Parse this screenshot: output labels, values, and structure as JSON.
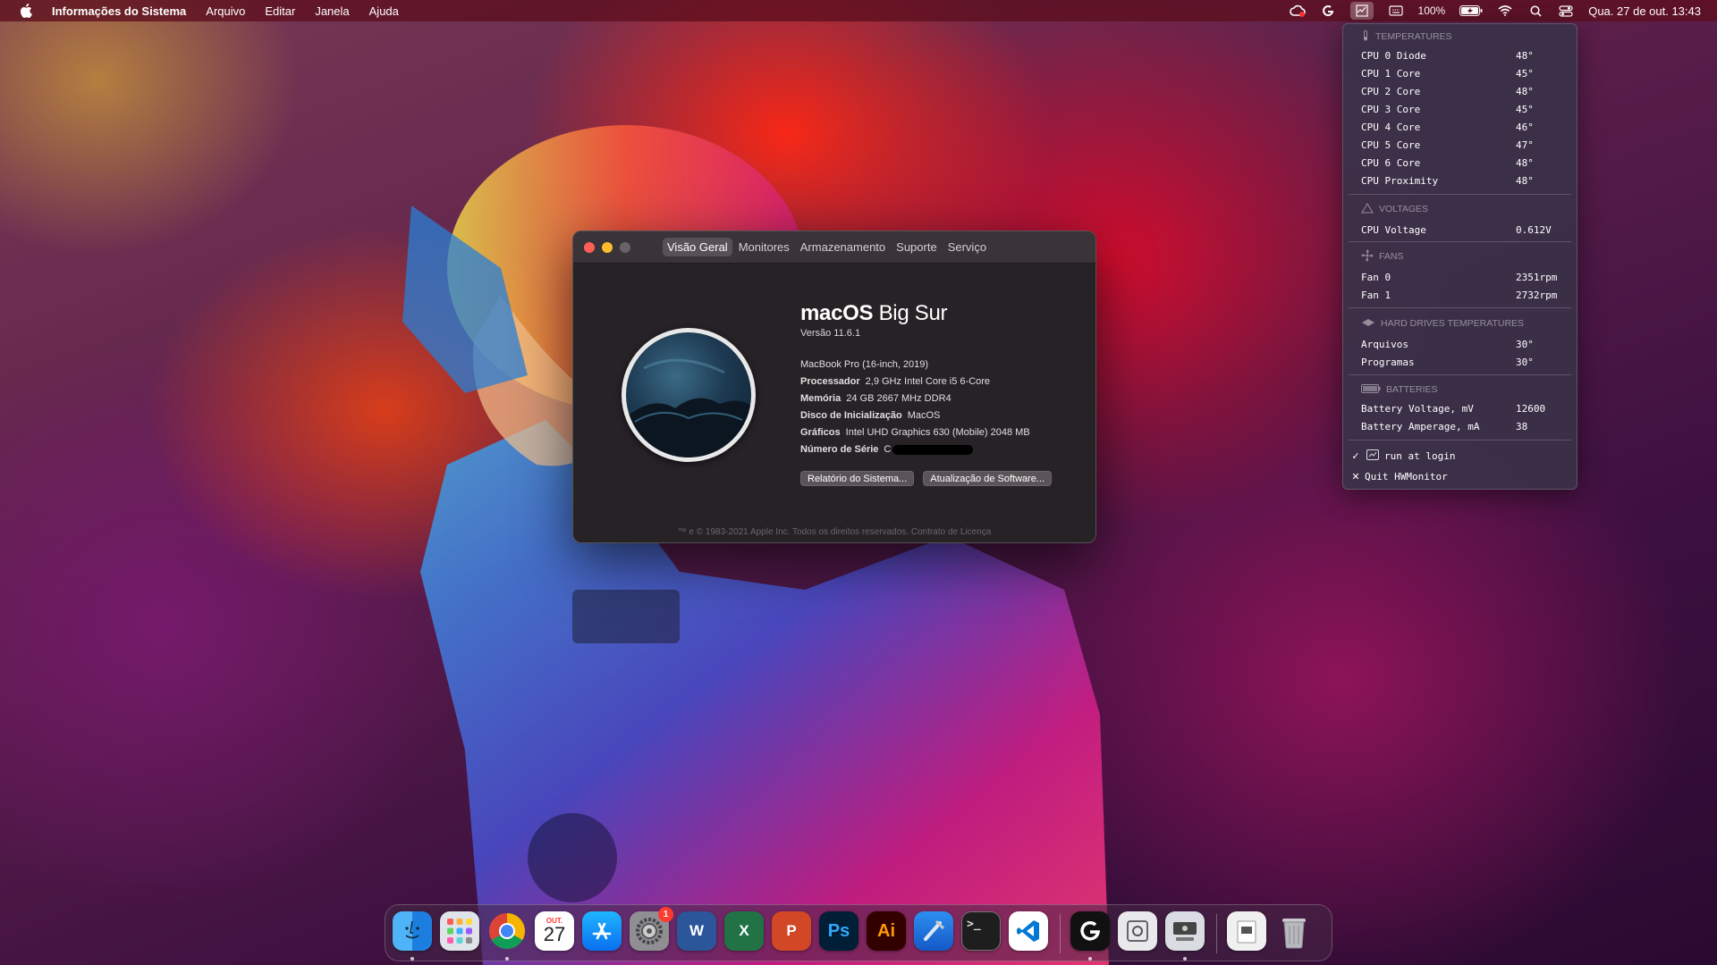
{
  "menubar": {
    "app_name": "Informações do Sistema",
    "items": [
      "Arquivo",
      "Editar",
      "Janela",
      "Ajuda"
    ],
    "status_icons": [
      "creative-cloud-icon",
      "logitech-icon",
      "hwmonitor-icon",
      "keyboard-icon",
      "battery-icon",
      "wifi-icon",
      "spotlight-icon",
      "control-center-icon"
    ],
    "battery_percent": "100%",
    "clock": "Qua. 27 de out.  13:43"
  },
  "hwmonitor": {
    "sections": {
      "temperatures": "TEMPERATURES",
      "voltages": "VOLTAGES",
      "fans": "FANS",
      "drives": "HARD DRIVES TEMPERATURES",
      "batteries": "BATTERIES"
    },
    "temperatures": [
      {
        "name": "CPU 0 Diode",
        "value": "48°"
      },
      {
        "name": "CPU 1 Core",
        "value": "45°"
      },
      {
        "name": "CPU 2 Core",
        "value": "48°"
      },
      {
        "name": "CPU 3 Core",
        "value": "45°"
      },
      {
        "name": "CPU 4 Core",
        "value": "46°"
      },
      {
        "name": "CPU 5 Core",
        "value": "47°"
      },
      {
        "name": "CPU 6 Core",
        "value": "48°"
      },
      {
        "name": "CPU Proximity",
        "value": "48°"
      }
    ],
    "voltages": [
      {
        "name": "CPU Voltage",
        "value": "0.612V"
      }
    ],
    "fans": [
      {
        "name": "Fan 0",
        "value": "2351rpm"
      },
      {
        "name": "Fan 1",
        "value": "2732rpm"
      }
    ],
    "drives": [
      {
        "name": "Arquivos",
        "value": "30°"
      },
      {
        "name": "Programas",
        "value": "30°"
      }
    ],
    "batteries": [
      {
        "name": "Battery Voltage, mV",
        "value": "12600"
      },
      {
        "name": "Battery Amperage, mA",
        "value": "38"
      }
    ],
    "run_at_login": "run at login",
    "quit": "Quit HWMonitor"
  },
  "about_window": {
    "tabs": [
      "Visão Geral",
      "Monitores",
      "Armazenamento",
      "Suporte",
      "Serviço"
    ],
    "active_tab": "Visão Geral",
    "os_name_bold": "macOS",
    "os_name_light": " Big Sur",
    "version": "Versão 11.6.1",
    "model": "MacBook Pro (16-inch, 2019)",
    "specs": [
      {
        "key": "Processador",
        "value": "2,9 GHz Intel Core i5 6-Core"
      },
      {
        "key": "Memória",
        "value": "24 GB 2667 MHz DDR4"
      },
      {
        "key": "Disco de Inicialização",
        "value": "MacOS"
      },
      {
        "key": "Gráficos",
        "value": "Intel UHD Graphics 630 (Mobile) 2048 MB"
      }
    ],
    "serial_label": "Número de Série",
    "serial_value": "C",
    "buttons": [
      "Relatório do Sistema...",
      "Atualização de Software..."
    ],
    "footer": "™ e © 1983-2021 Apple Inc. Todos os direitos reservados. Contrato de Licença"
  },
  "dock": {
    "apps": [
      {
        "name": "Finder",
        "icon": "finder-icon"
      },
      {
        "name": "Launchpad",
        "icon": "launchpad-icon"
      },
      {
        "name": "Google Chrome",
        "icon": "chrome-icon"
      },
      {
        "name": "Calendário",
        "icon": "calendar-icon",
        "month": "OUT.",
        "day": "27"
      },
      {
        "name": "App Store",
        "icon": "app-store-icon"
      },
      {
        "name": "Preferências do Sistema",
        "icon": "system-preferences-icon",
        "badge": "1"
      },
      {
        "name": "Microsoft Word",
        "icon": "word-icon",
        "label": "W"
      },
      {
        "name": "Microsoft Excel",
        "icon": "excel-icon",
        "label": "X"
      },
      {
        "name": "Microsoft PowerPoint",
        "icon": "powerpoint-icon",
        "label": "P"
      },
      {
        "name": "Adobe Photoshop",
        "icon": "photoshop-icon",
        "label": "Ps"
      },
      {
        "name": "Adobe Illustrator",
        "icon": "illustrator-icon",
        "label": "Ai"
      },
      {
        "name": "Xcode",
        "icon": "xcode-icon"
      },
      {
        "name": "Terminal",
        "icon": "terminal-icon",
        "label": ">_"
      },
      {
        "name": "Visual Studio Code",
        "icon": "vscode-icon"
      },
      {
        "name": "Logitech G HUB",
        "icon": "logitech-g-icon"
      },
      {
        "name": "Utilitário",
        "icon": "utility-icon"
      },
      {
        "name": "Informações do Sistema",
        "icon": "system-information-icon"
      },
      {
        "name": "Documentos",
        "icon": "documents-folder-icon"
      },
      {
        "name": "Lixo",
        "icon": "trash-icon"
      }
    ],
    "colors": {
      "word": "#2b579a",
      "excel": "#217346",
      "powerpoint": "#d24726",
      "photoshop": "#001e36",
      "illustrator": "#330000",
      "vscode": "#0078d4"
    }
  }
}
